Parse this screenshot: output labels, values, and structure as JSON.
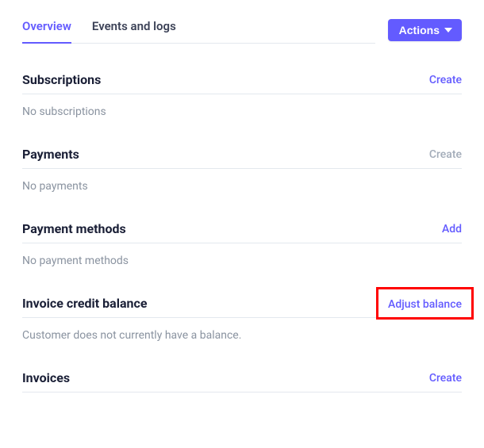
{
  "tabs": {
    "overview": "Overview",
    "events_and_logs": "Events and logs"
  },
  "actions_label": "Actions",
  "sections": {
    "subscriptions": {
      "title": "Subscriptions",
      "action": "Create",
      "empty": "No subscriptions"
    },
    "payments": {
      "title": "Payments",
      "action": "Create",
      "empty": "No payments"
    },
    "payment_methods": {
      "title": "Payment methods",
      "action": "Add",
      "empty": "No payment methods"
    },
    "invoice_credit_balance": {
      "title": "Invoice credit balance",
      "action": "Adjust balance",
      "empty": "Customer does not currently have a balance."
    },
    "invoices": {
      "title": "Invoices",
      "action": "Create"
    }
  }
}
